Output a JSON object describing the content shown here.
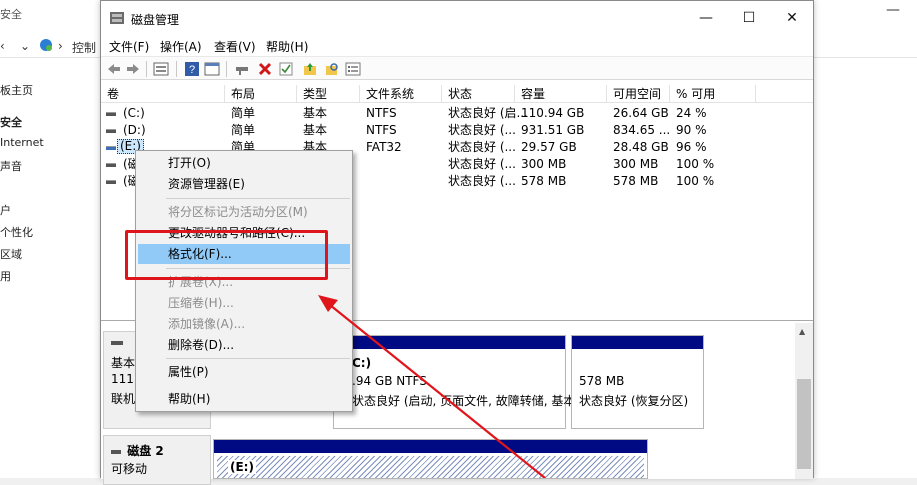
{
  "background_window": {
    "title_fragment": "安全",
    "address_label": "控制",
    "nav_items": [
      "板主页",
      "安全",
      "Internet",
      "声音",
      "户",
      "个性化",
      "区域",
      "用"
    ]
  },
  "window": {
    "title": "磁盘管理",
    "controls": {
      "minimize": "—",
      "maximize": "☐",
      "close": "✕"
    }
  },
  "menu": [
    "文件(F)",
    "操作(A)",
    "查看(V)",
    "帮助(H)"
  ],
  "toolbar": [
    "back-icon",
    "forward-icon",
    "properties-icon",
    "help-icon",
    "view-icon",
    "connect-icon",
    "delete-icon",
    "check-icon",
    "folder-up-icon",
    "search-icon",
    "list-icon"
  ],
  "columns": [
    "卷",
    "布局",
    "类型",
    "文件系统",
    "状态",
    "容量",
    "可用空间",
    "% 可用"
  ],
  "volumes": [
    {
      "name": "(C:)",
      "layout": "简单",
      "type": "基本",
      "fs": "NTFS",
      "status": "状态良好 (启...",
      "capacity": "110.94 GB",
      "free": "26.64 GB",
      "pct": "24 %"
    },
    {
      "name": "(D:)",
      "layout": "简单",
      "type": "基本",
      "fs": "NTFS",
      "status": "状态良好 (...",
      "capacity": "931.51 GB",
      "free": "834.65 ...",
      "pct": "90 %"
    },
    {
      "name": "(E:)",
      "layout": "简单",
      "type": "基本",
      "fs": "FAT32",
      "status": "状态良好 (...",
      "capacity": "29.57 GB",
      "free": "28.48 GB",
      "pct": "96 %"
    },
    {
      "name": "(磁",
      "layout": "",
      "type": "",
      "fs": "",
      "status": "状态良好 (...",
      "capacity": "300 MB",
      "free": "300 MB",
      "pct": "100 %"
    },
    {
      "name": "(磁",
      "layout": "",
      "type": "",
      "fs": "",
      "status": "状态良好 (...",
      "capacity": "578 MB",
      "free": "578 MB",
      "pct": "100 %"
    }
  ],
  "disks": [
    {
      "label_lines": [
        "基本",
        "111.",
        "联机"
      ],
      "partitions": [
        {
          "lines": [
            "C:)",
            ".94 GB NTFS",
            "状态良好 (启动, 页面文件, 故障转储, 基本数"
          ]
        },
        {
          "lines": [
            "578 MB",
            "状态良好 (恢复分区)"
          ]
        }
      ]
    },
    {
      "name": "磁盘 2",
      "label_lines": [
        "可移动"
      ],
      "partitions": [
        {
          "lines": [
            "(E:)"
          ]
        }
      ]
    }
  ],
  "context_menu": {
    "items": [
      {
        "label": "打开(O)",
        "enabled": true
      },
      {
        "label": "资源管理器(E)",
        "enabled": true
      },
      {
        "label": "将分区标记为活动分区(M)",
        "enabled": false
      },
      {
        "label": "更改驱动器号和路径(C)...",
        "enabled": true
      },
      {
        "label": "格式化(F)...",
        "enabled": true,
        "highlighted": true
      },
      {
        "label": "扩展卷(X)...",
        "enabled": false
      },
      {
        "label": "压缩卷(H)...",
        "enabled": false
      },
      {
        "label": "添加镜像(A)...",
        "enabled": false
      },
      {
        "label": "删除卷(D)...",
        "enabled": true
      },
      {
        "label": "属性(P)",
        "enabled": true
      },
      {
        "label": "帮助(H)",
        "enabled": true
      }
    ]
  },
  "annotation_color": "#e0151b"
}
